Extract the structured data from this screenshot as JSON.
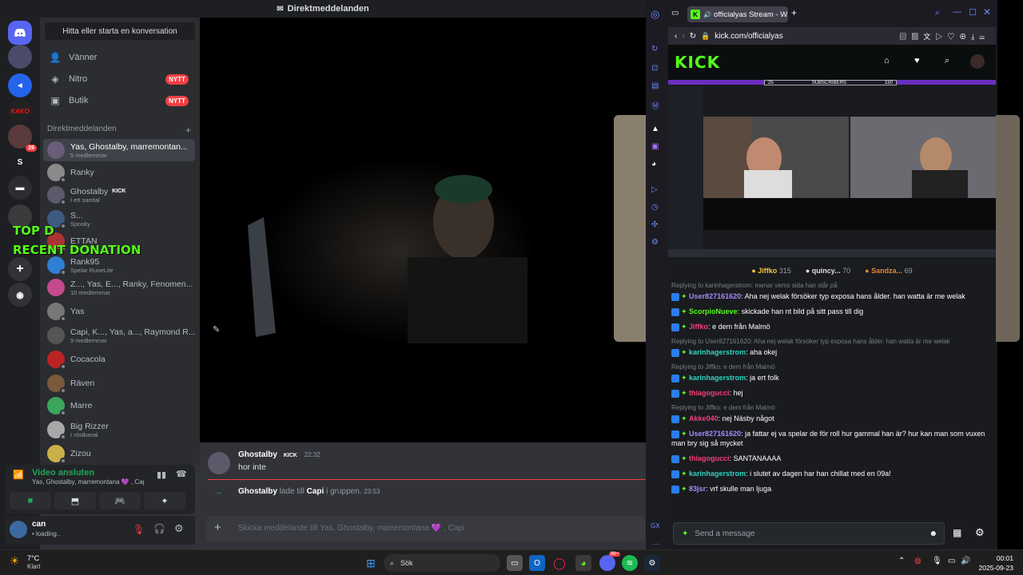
{
  "discord": {
    "title": "Direktmeddelanden",
    "find_conversation": "Hitta eller starta en konversation",
    "nav": [
      {
        "label": "Vänner",
        "icon": "friends-icon"
      },
      {
        "label": "Nitro",
        "icon": "nitro-icon",
        "badge": "NYTT"
      },
      {
        "label": "Butik",
        "icon": "shop-icon",
        "badge": "NYTT"
      }
    ],
    "dm_header": "Direktmeddelanden",
    "dm_add": "+",
    "dms": [
      {
        "name": "Yas, Ghostalby, marremontan...",
        "sub": "5 medlemmar",
        "selected": true,
        "color": "#6b5c7a"
      },
      {
        "name": "Ranky",
        "sub": "",
        "color": "#8a8a8a"
      },
      {
        "name": "Ghostalby",
        "sub": "I ett samtal",
        "kick": "KICK",
        "color": "#5a5a6a"
      },
      {
        "name": "S...",
        "sub": "Spooky",
        "color": "#3d5a80"
      },
      {
        "name": "ETTAN",
        "sub": "",
        "color": "#a33"
      },
      {
        "name": "Rank95",
        "sub": "Spelar RuneLite",
        "color": "#2f7fd3"
      },
      {
        "name": "Z..., Yas, E..., Ranky, Fenomen...",
        "sub": "10 medlemmar",
        "color": "#c34b8d"
      },
      {
        "name": "Yas",
        "sub": "",
        "color": "#777"
      },
      {
        "name": "Capi, K..., Yas, a..., Raymond R...",
        "sub": "9 medlemmar",
        "color": "#555"
      },
      {
        "name": "Cocacola",
        "sub": "",
        "color": "#b22"
      },
      {
        "name": "Räven",
        "sub": "",
        "color": "#7a5a3a"
      },
      {
        "name": "Marre",
        "sub": "",
        "color": "#3ba55c"
      },
      {
        "name": "Big Rizzer",
        "sub": "I röstkanal",
        "color": "#a8a8a8"
      },
      {
        "name": "Zizou",
        "sub": "",
        "color": "#c9b04a"
      }
    ],
    "overlay_top": "TOP D",
    "overlay_bottom": "RECENT DONATION",
    "voice_status": "Video ansluten",
    "voice_channel": "Yas, Ghostalby, marremontana 💜 , Capi",
    "user_name": "can",
    "user_status": "• loading..",
    "server_badge": "26",
    "chat": {
      "author": "Ghostalby",
      "author_badge": "KICK",
      "time": "22:32",
      "message": "hor inte",
      "system_author": "Ghostalby",
      "system_mid": "lade till",
      "system_target": "Capi",
      "system_end": "i gruppen.",
      "system_time": "23:53",
      "input_placeholder": "Skicka meddelande till Yas, Ghostalby, marremontana 💜 , Capi"
    }
  },
  "browser": {
    "tab_title": "officialyas Stream - W",
    "url": "kick.com/officialyas",
    "kick_logo": "KICK",
    "subscribers_left": "25",
    "subscribers_label": "SUBSCRIBERS",
    "subscribers_right": "150",
    "leaderboard": [
      {
        "name": "Jiffko",
        "value": "315",
        "color": "#f5c542"
      },
      {
        "name": "quincy...",
        "value": "70",
        "color": "#dddddd"
      },
      {
        "name": "Sandza...",
        "value": "69",
        "color": "#e0893a"
      }
    ],
    "messages": [
      {
        "reply": "Replying to karinhagerstrom: menar vems sida han står på",
        "user": "User827161620",
        "color": "#a78bfa",
        "text": "Aha nej welak försöker typ exposa hans ålder. han watta är me welak"
      },
      {
        "reply": "",
        "user": "ScorpioNueve",
        "color": "#53fc18",
        "text": "skickade han nt bild på sitt pass till dig"
      },
      {
        "reply": "",
        "user": "Jiffko",
        "color": "#f23f77",
        "text": "e dem från Malmö"
      },
      {
        "reply": "Replying to User827161620: Aha nej welak försöker typ exposa hans ålder. han watta är me welak",
        "user": "karinhagerstrom",
        "color": "#2dd4bf",
        "text": "aha okej"
      },
      {
        "reply": "Replying to Jiffko: e dem från Malmö",
        "user": "karinhagerstrom",
        "color": "#2dd4bf",
        "text": "ja ert folk"
      },
      {
        "reply": "",
        "user": "thiagogucci",
        "color": "#f23f77",
        "text": "hej"
      },
      {
        "reply": "Replying to Jiffko: e dem från Malmö",
        "user": "Akke040",
        "color": "#f23f77",
        "text": "nej Näsby något"
      },
      {
        "reply": "",
        "user": "User827161620",
        "color": "#a78bfa",
        "text": "ja fattar ej va spelar de för roll hur gammal han är? hur kan man som vuxen man bry sig så mycket"
      },
      {
        "reply": "",
        "user": "thiagogucci",
        "color": "#f23f77",
        "text": "SANTANAAAA"
      },
      {
        "reply": "",
        "user": "karinhagerstrom",
        "color": "#2dd4bf",
        "text": "i slutet av dagen har han chillat med en 09a!"
      },
      {
        "reply": "",
        "user": "83jsr",
        "color": "#a78bfa",
        "text": "vrf skulle man ljuga"
      }
    ],
    "send_placeholder": "Send a message"
  },
  "taskbar": {
    "weather_temp": "7°C",
    "weather_text": "Klart",
    "search_label": "Sök",
    "time": "00:01",
    "date": "2025-09-23",
    "steam_badge": "99+"
  },
  "colors": {
    "kick_green": "#53fc18",
    "discord_bg": "#313338",
    "discord_sidebar": "#2b2d31",
    "discord_rail": "#1e1f22",
    "badge_red": "#f23f43"
  }
}
